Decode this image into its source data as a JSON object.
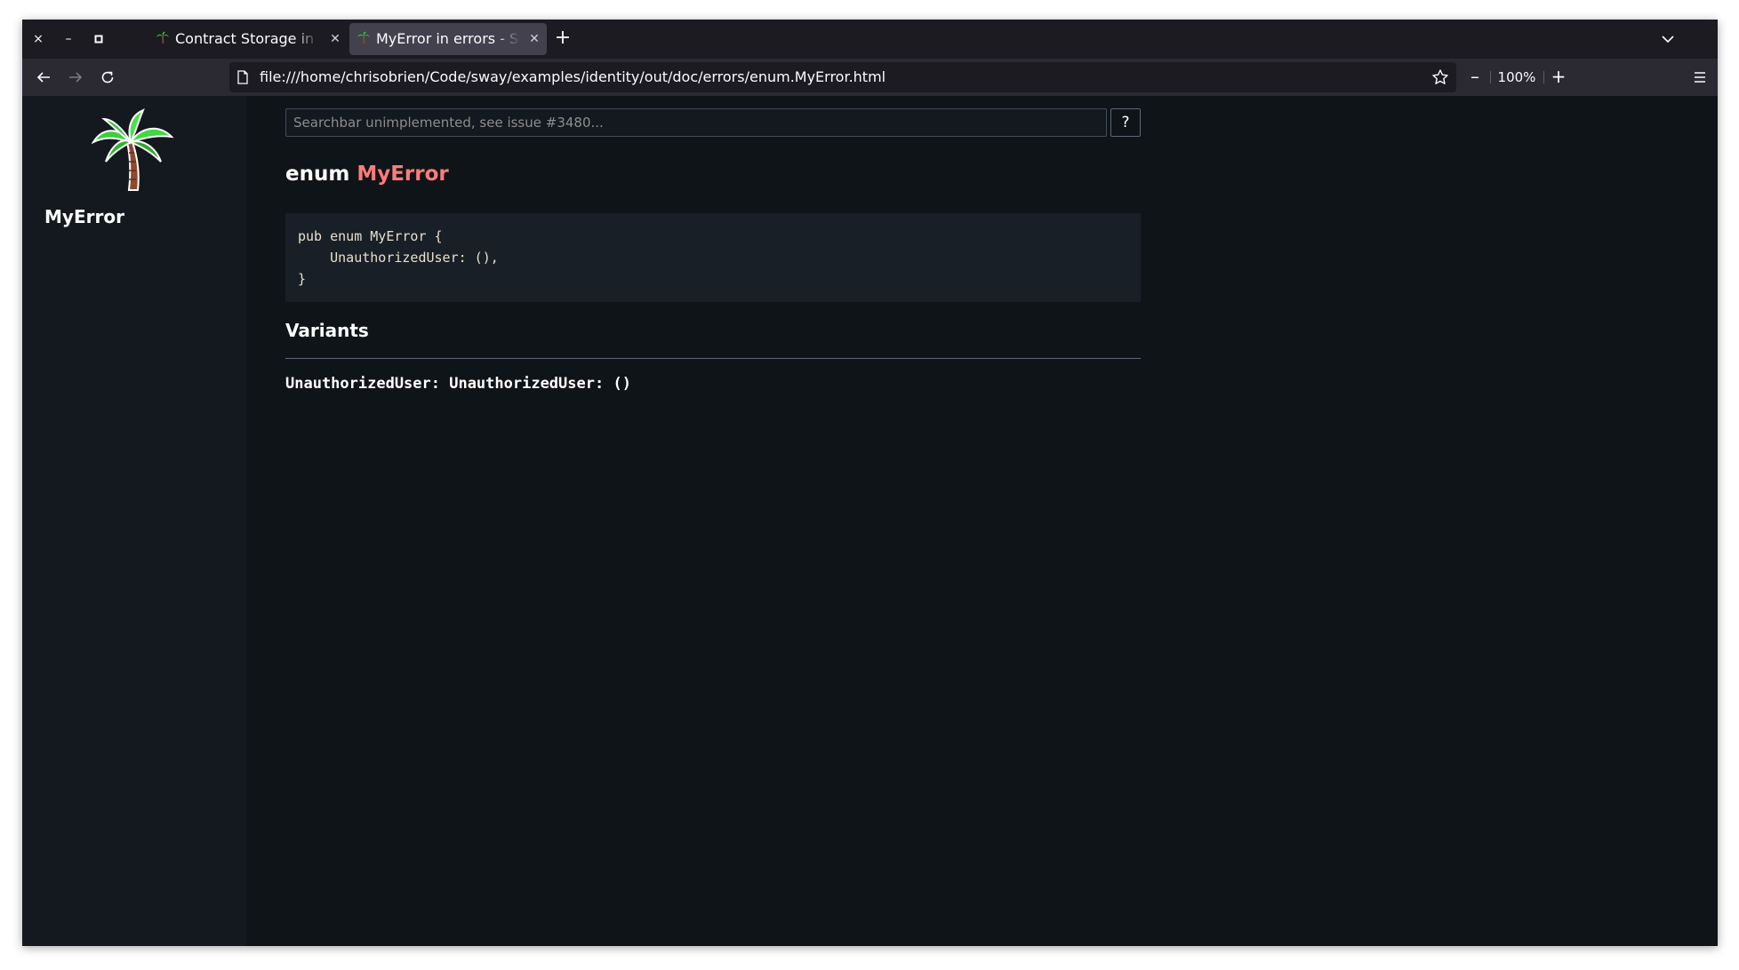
{
  "browser": {
    "window_controls": {
      "close": "×",
      "minimize": "–",
      "maximize": "□"
    },
    "tabs": [
      {
        "title": "Contract Storage in storage - Sway",
        "active": false
      },
      {
        "title": "MyError in errors - Sway",
        "active": true
      }
    ],
    "new_tab": "+",
    "url": "file:///home/chrisobrien/Code/sway/examples/identity/out/doc/errors/enum.MyError.html",
    "zoom": {
      "minus": "–",
      "level": "100%",
      "plus": "+"
    }
  },
  "sidebar": {
    "title": "MyError"
  },
  "search": {
    "placeholder": "Searchbar unimplemented, see issue #3480...",
    "help_label": "?"
  },
  "page": {
    "title_keyword": "enum",
    "title_name": "MyError",
    "code": "pub enum MyError {\n    UnauthorizedUser: (),\n}",
    "variants_heading": "Variants",
    "variants": [
      "UnauthorizedUser: UnauthorizedUser: ()"
    ]
  },
  "colors": {
    "background": "#0f1419",
    "sidebar": "#14191f",
    "code_background": "#191f26",
    "enum_name": "#ff7c79",
    "browser_chrome": "#2b2a33",
    "tab_strip": "#1c1b22"
  }
}
